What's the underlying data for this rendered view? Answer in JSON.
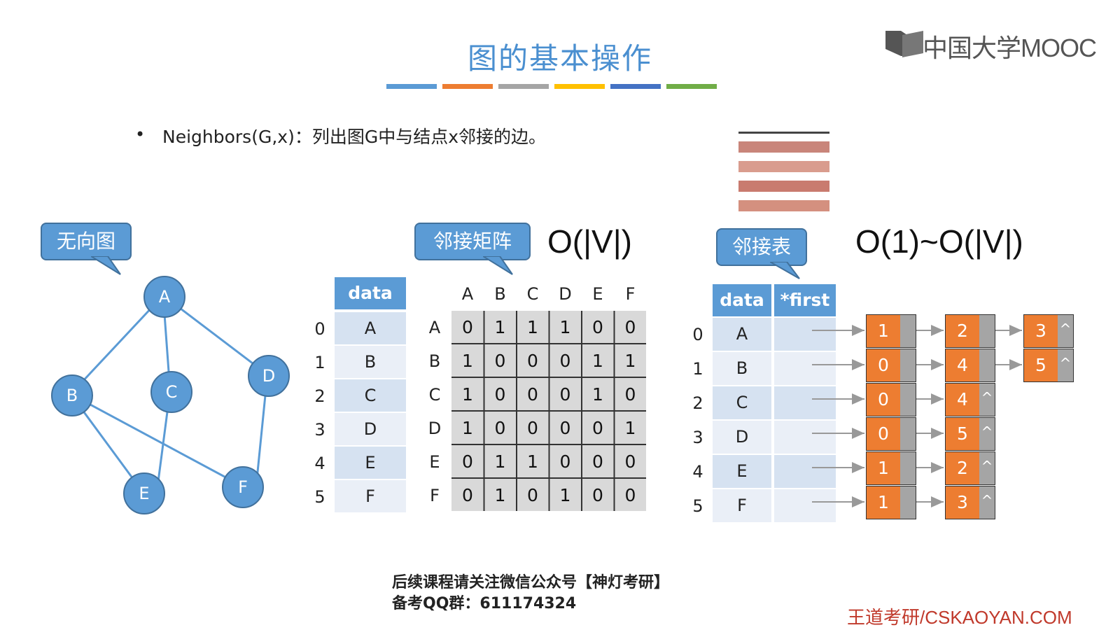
{
  "slide": {
    "title": "图的基本操作",
    "title_bar_colors": [
      "#5b9bd5",
      "#ed7d31",
      "#a5a5a5",
      "#ffc000",
      "#4472c4",
      "#70ad47"
    ],
    "bullet_symbol": "•",
    "bullet_text": "Neighbors(G,x)：列出图G中与结点x邻接的边。",
    "logo_text": "中国大学MOOC",
    "footer_line1": "后续课程请关注微信公众号【神灯考研】",
    "footer_line2": "备考QQ群：611174324",
    "brand": "王道考研/CSKAOYAN.COM"
  },
  "undirected_graph": {
    "label": "无向图",
    "nodes": [
      "A",
      "B",
      "C",
      "D",
      "E",
      "F"
    ],
    "edges": [
      [
        "A",
        "B"
      ],
      [
        "A",
        "C"
      ],
      [
        "A",
        "D"
      ],
      [
        "B",
        "E"
      ],
      [
        "B",
        "F"
      ],
      [
        "C",
        "E"
      ],
      [
        "D",
        "F"
      ]
    ]
  },
  "adj_matrix": {
    "label": "邻接矩阵",
    "complexity": "O(|V|)",
    "data_header": "data",
    "indices": [
      "0",
      "1",
      "2",
      "3",
      "4",
      "5"
    ],
    "data": [
      "A",
      "B",
      "C",
      "D",
      "E",
      "F"
    ],
    "columns": [
      "A",
      "B",
      "C",
      "D",
      "E",
      "F"
    ],
    "rows": [
      "A",
      "B",
      "C",
      "D",
      "E",
      "F"
    ],
    "matrix": [
      [
        "0",
        "1",
        "1",
        "1",
        "0",
        "0"
      ],
      [
        "1",
        "0",
        "0",
        "0",
        "1",
        "1"
      ],
      [
        "1",
        "0",
        "0",
        "0",
        "1",
        "0"
      ],
      [
        "1",
        "0",
        "0",
        "0",
        "0",
        "1"
      ],
      [
        "0",
        "1",
        "1",
        "0",
        "0",
        "0"
      ],
      [
        "0",
        "1",
        "0",
        "1",
        "0",
        "0"
      ]
    ]
  },
  "adj_list": {
    "label": "邻接表",
    "complexity": "O(1)~O(|V|)",
    "data_header": "data",
    "first_header": "*first",
    "indices": [
      "0",
      "1",
      "2",
      "3",
      "4",
      "5"
    ],
    "data": [
      "A",
      "B",
      "C",
      "D",
      "E",
      "F"
    ],
    "null_symbol": "^",
    "lists": [
      [
        "1",
        "2",
        "3"
      ],
      [
        "0",
        "4",
        "5"
      ],
      [
        "0",
        "4"
      ],
      [
        "0",
        "5"
      ],
      [
        "1",
        "2"
      ],
      [
        "1",
        "3"
      ]
    ]
  },
  "colors": {
    "accent_blue": "#5b9bd5",
    "accent_orange": "#ed7d31",
    "pointer_gray": "#a5a5a5",
    "brand_red": "#c0392b"
  }
}
